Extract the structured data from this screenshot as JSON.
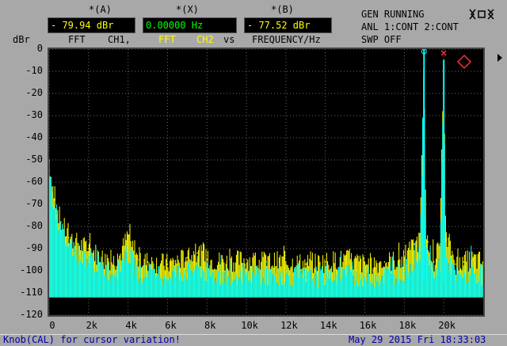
{
  "cursors": [
    {
      "name": "*(A)",
      "value": "- 79.94 dBr",
      "color": "#ffff00"
    },
    {
      "name": "*(X)",
      "value": "0.00000 Hz",
      "color": "#00ff00"
    },
    {
      "name": "*(B)",
      "value": "- 77.52 dBr",
      "color": "#ffff00"
    }
  ],
  "gen_status": {
    "line1": "GEN RUNNING",
    "line2": "ANL 1:CONT 2:CONT",
    "line3": "SWP OFF"
  },
  "axis_label_left": {
    "unit": "dBr",
    "fft1": "FFT",
    "ch1": "CH1,",
    "fft2": "FFT",
    "ch2": "CH2",
    "vs": "vs",
    "x": "FREQUENCY/Hz"
  },
  "brand_icon": "rohde-schwarz-logo",
  "status_bar": {
    "message": "Knob(CAL) for cursor variation!",
    "datetime": "May 29 2015 Fri 18:33:03"
  },
  "chart_data": {
    "type": "line",
    "ylabel": "dBr",
    "xlabel": "FREQUENCY/Hz",
    "ylim": [
      -120,
      0
    ],
    "xlim": [
      0,
      22000
    ],
    "yticks": [
      0,
      -10,
      -20,
      -30,
      -40,
      -50,
      -60,
      -70,
      -80,
      -90,
      -100,
      -110,
      -120
    ],
    "xticks": [
      {
        "v": 0,
        "label": "0"
      },
      {
        "v": 2000,
        "label": "2k"
      },
      {
        "v": 4000,
        "label": "4k"
      },
      {
        "v": 6000,
        "label": "6k"
      },
      {
        "v": 8000,
        "label": "8k"
      },
      {
        "v": 10000,
        "label": "10k"
      },
      {
        "v": 12000,
        "label": "12k"
      },
      {
        "v": 14000,
        "label": "14k"
      },
      {
        "v": 16000,
        "label": "16k"
      },
      {
        "v": 18000,
        "label": "18k"
      },
      {
        "v": 20000,
        "label": "20k"
      }
    ],
    "grid": true,
    "series": [
      {
        "name": "CH1",
        "color": "#ffff00",
        "x": [
          0,
          100,
          300,
          600,
          1000,
          1500,
          2000,
          2500,
          3000,
          3500,
          4000,
          4500,
          5000,
          6000,
          7000,
          7500,
          8000,
          9000,
          10000,
          11000,
          12000,
          13000,
          14000,
          15000,
          16000,
          17000,
          18000,
          18500,
          18800,
          19000,
          19100,
          19200,
          19500,
          19800,
          20000,
          20100,
          20300,
          20600,
          21000,
          21500,
          22000
        ],
        "y": [
          -50,
          -58,
          -68,
          -78,
          -85,
          -88,
          -90,
          -93,
          -96,
          -95,
          -84,
          -95,
          -96,
          -97,
          -94,
          -92,
          -95,
          -96,
          -95,
          -96,
          -96,
          -97,
          -96,
          -95,
          -97,
          -96,
          -95,
          -88,
          -86,
          -5,
          -86,
          -87,
          -96,
          -88,
          -5,
          -86,
          -88,
          -97,
          -96,
          -95,
          -96
        ]
      },
      {
        "name": "CH2",
        "color": "#00ffff",
        "x": [
          0,
          100,
          300,
          600,
          1000,
          1500,
          2000,
          2500,
          3000,
          3500,
          4000,
          4500,
          5000,
          6000,
          7000,
          7500,
          8000,
          9000,
          10000,
          11000,
          12000,
          13000,
          14000,
          15000,
          16000,
          17000,
          18000,
          18500,
          18800,
          19000,
          19100,
          19200,
          19500,
          19800,
          20000,
          20100,
          20300,
          20600,
          21000,
          21500,
          22000
        ],
        "y": [
          -55,
          -62,
          -72,
          -82,
          -88,
          -92,
          -94,
          -97,
          -100,
          -99,
          -92,
          -100,
          -101,
          -102,
          -100,
          -98,
          -101,
          -102,
          -101,
          -102,
          -102,
          -103,
          -102,
          -101,
          -103,
          -102,
          -101,
          -95,
          -92,
          0,
          -92,
          -94,
          -104,
          -96,
          -10,
          -94,
          -96,
          -103,
          -102,
          -101,
          -102
        ]
      }
    ]
  }
}
